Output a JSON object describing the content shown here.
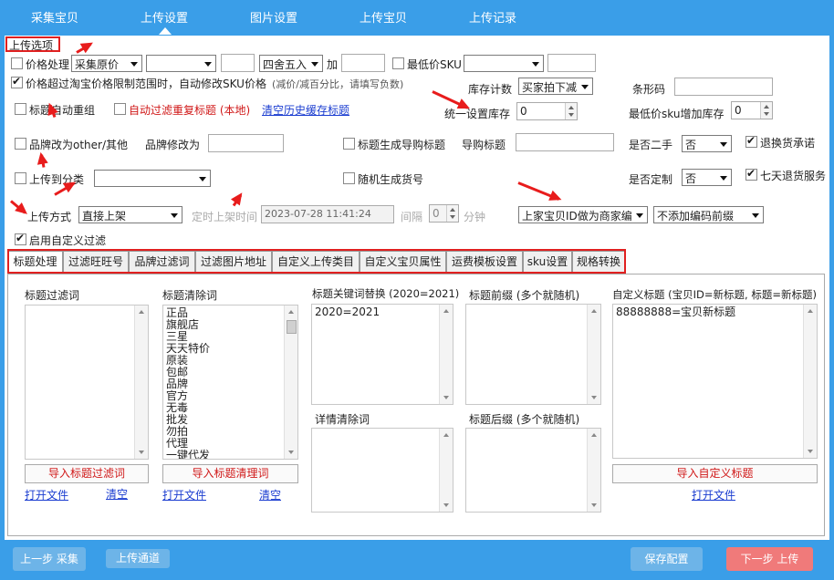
{
  "nav": {
    "tabs": [
      "采集宝贝",
      "上传设置",
      "图片设置",
      "上传宝贝",
      "上传记录"
    ],
    "active_index": 1
  },
  "group_title": "上传选项",
  "price": {
    "checkbox_label": "价格处理",
    "base_select": "采集原价",
    "op_select": "",
    "op_value": "",
    "rounding_select": "四舍五入",
    "add_label": "加",
    "add_value": "",
    "min_sku_label": "最低价SKU",
    "min_sku_select": "",
    "min_sku_value": "",
    "auto_modify_label": "价格超过淘宝价格限制范围时，自动修改SKU价格",
    "auto_modify_hint": "(减价/减百分比，请填写负数)"
  },
  "stock": {
    "count_label": "库存计数",
    "count_select": "买家拍下减",
    "barcode_label": "条形码",
    "barcode_value": "",
    "unify_label": "统一设置库存",
    "unify_value": "0",
    "min_sku_add_label": "最低价sku增加库存",
    "min_sku_add_value": "0"
  },
  "title": {
    "auto_group_label": "标题自动重组",
    "auto_filter_label": "自动过滤重复标题 (本地)",
    "clear_cache_link": "清空历史缓存标题"
  },
  "brand": {
    "change_other_label": "品牌改为other/其他",
    "modify_label": "品牌修改为",
    "modify_value": "",
    "gen_guide_label": "标题生成导购标题",
    "guide_title_label": "导购标题",
    "guide_title_value": ""
  },
  "second_hand": {
    "label": "是否二手",
    "value": "否"
  },
  "return_promise": {
    "label": "退换货承诺"
  },
  "category": {
    "upload_to_label": "上传到分类",
    "select": ""
  },
  "random_code_label": "随机生成货号",
  "custom_made": {
    "label": "是否定制",
    "value": "否"
  },
  "seven_day_label": "七天退货服务",
  "upload_mode": {
    "label": "上传方式",
    "select": "直接上架",
    "timed_label": "定时上架时间",
    "timed_value": "2023-07-28  11:41:24",
    "interval_label": "间隔",
    "interval_value": "0",
    "minutes_label": "分钟"
  },
  "merchant_code_select": "上家宝贝ID做为商家编",
  "prefix_select": "不添加编码前缀",
  "custom_filter_label": "启用自定义过滤",
  "sub_tabs": [
    "标题处理",
    "过滤旺旺号",
    "品牌过滤词",
    "过滤图片地址",
    "自定义上传类目",
    "自定义宝贝属性",
    "运费模板设置",
    "sku设置",
    "规格转换"
  ],
  "sub_active_index": 0,
  "panels": {
    "filter_words": {
      "header": "标题过滤词",
      "content": "",
      "import_button": "导入标题过滤词",
      "open_link": "打开文件",
      "clear_link": "清空"
    },
    "clear_words": {
      "header": "标题清除词",
      "content": "正品\n旗舰店\n三星\n天天特价\n原装\n包邮\n品牌\n官方\n无毒\n批发\n勿拍\n代理\n一键代发",
      "import_button": "导入标题清理词",
      "open_link": "打开文件",
      "clear_link": "清空"
    },
    "keyword_replace": {
      "header": "标题关键词替换 (2020=2021)",
      "content": "2020=2021"
    },
    "detail_clear": {
      "header": "详情清除词",
      "content": ""
    },
    "prefix": {
      "header": "标题前缀 (多个就随机)",
      "content": ""
    },
    "suffix": {
      "header": "标题后缀 (多个就随机)",
      "content": ""
    },
    "custom_title": {
      "header": "自定义标题 (宝贝ID=新标题, 标题=新标题)",
      "content": "88888888=宝贝新标题",
      "import_button": "导入自定义标题",
      "open_link": "打开文件"
    }
  },
  "footer": {
    "prev_button": "上一步 采集",
    "channel_button": "上传通道",
    "save_button": "保存配置",
    "next_button": "下一步 上传"
  },
  "colors": {
    "background": "#3a9ee8",
    "footer_blue": "#6db4e8",
    "next_red": "#f07a7a",
    "annotation_red": "#e02020"
  }
}
